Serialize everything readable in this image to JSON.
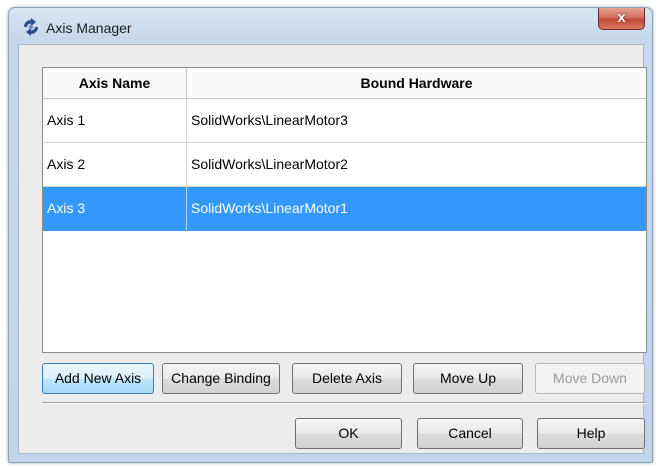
{
  "window": {
    "title": "Axis Manager",
    "close_label": "x",
    "icon": "axis-manager-app-icon"
  },
  "table": {
    "headers": [
      "Axis Name",
      "Bound Hardware"
    ],
    "rows": [
      {
        "axis": "Axis 1",
        "hardware": "SolidWorks\\LinearMotor3",
        "selected": false
      },
      {
        "axis": "Axis 2",
        "hardware": "SolidWorks\\LinearMotor2",
        "selected": false
      },
      {
        "axis": "Axis 3",
        "hardware": "SolidWorks\\LinearMotor1",
        "selected": true
      }
    ]
  },
  "actions": {
    "add_new_axis": "Add New Axis",
    "change_binding": "Change Binding",
    "delete_axis": "Delete Axis",
    "move_up": "Move Up",
    "move_down": "Move Down"
  },
  "dialog_buttons": {
    "ok": "OK",
    "cancel": "Cancel",
    "help": "Help"
  },
  "colors": {
    "selection": "#3399ff",
    "close_button": "#c24a37"
  }
}
